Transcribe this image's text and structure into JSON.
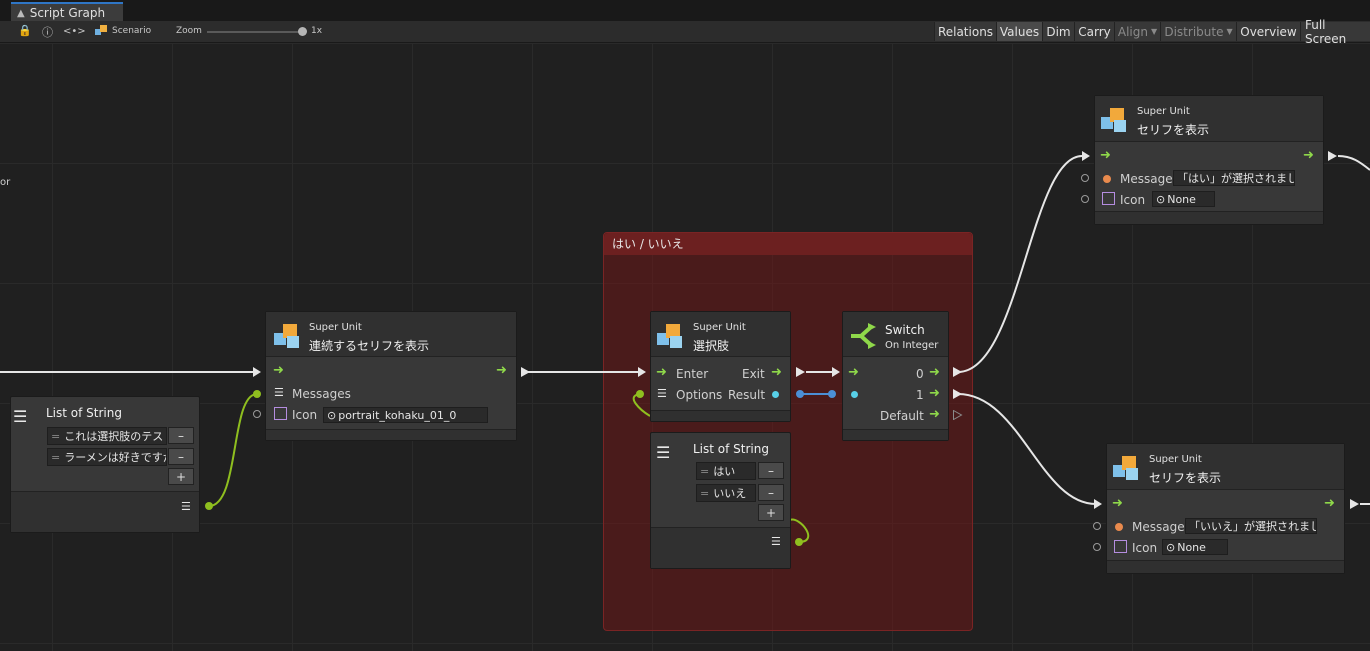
{
  "window": {
    "tab_title": "Script Graph"
  },
  "toolbar": {
    "scenario_label": "Scenario",
    "zoom_label": "Zoom",
    "zoom_value": "1x",
    "buttons": [
      "Relations",
      "Values",
      "Dim",
      "Carry",
      "Align",
      "Distribute",
      "Overview",
      "Full Screen"
    ],
    "active_button": "Values",
    "disabled_buttons": [
      "Align",
      "Distribute"
    ]
  },
  "left_edge_text": "or",
  "group": {
    "title": "はい / いいえ"
  },
  "nodes": {
    "list_left": {
      "title": "List of String",
      "items": [
        "これは選択肢のテス",
        "ラーメンは好きですか"
      ]
    },
    "superunit_messages": {
      "kind": "Super Unit",
      "title": "連続するセリフを表示",
      "messages_label": "Messages",
      "icon_label": "Icon",
      "icon_value": "portrait_kohaku_01_0"
    },
    "superunit_choice": {
      "kind": "Super Unit",
      "title": "選択肢",
      "enter_label": "Enter",
      "exit_label": "Exit",
      "options_label": "Options",
      "result_label": "Result"
    },
    "list_mid": {
      "title": "List of String",
      "items": [
        "はい",
        "いいえ"
      ]
    },
    "switch": {
      "title": "Switch",
      "subtitle": "On Integer",
      "case0": "0",
      "case1": "1",
      "default_label": "Default"
    },
    "superunit_yes": {
      "kind": "Super Unit",
      "title": "セリフを表示",
      "message_label": "Message",
      "message_value": "「はい」が選択されました",
      "icon_label": "Icon",
      "icon_value": "None"
    },
    "superunit_no": {
      "kind": "Super Unit",
      "title": "セリフを表示",
      "message_label": "Message",
      "message_value": "「いいえ」が選択されました",
      "icon_label": "Icon",
      "icon_value": "None"
    }
  },
  "colors": {
    "control_flow": "#8fd84a",
    "value_wire": "#8fbf1f",
    "result_wire": "#4b8fd6",
    "group": "#6c2020"
  }
}
